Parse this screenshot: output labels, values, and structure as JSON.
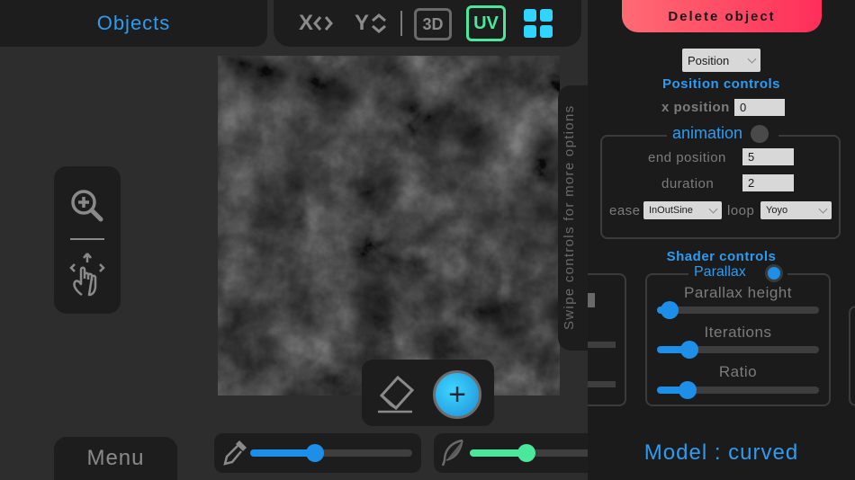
{
  "header": {
    "objects_label": "Objects",
    "toolbar": {
      "x_label": "X",
      "y_label": "Y",
      "three_d_label": "3D",
      "uv_label": "UV"
    }
  },
  "canvas": {
    "image": "cloudy noise texture"
  },
  "paint": {
    "add_symbol": "+"
  },
  "menu": {
    "label": "Menu"
  },
  "sliders": {
    "brush_size": 0.4,
    "softness": 0.45
  },
  "swipe_hint": "Swipe controls for more options",
  "right_panel": {
    "delete_label": "Delete object",
    "mode_select": "Position",
    "position_controls_title": "Position controls",
    "x_position_label": "x position",
    "x_position_value": "0",
    "animation_label": "animation",
    "end_position_label": "end position",
    "end_position_value": "5",
    "duration_label": "duration",
    "duration_value": "2",
    "ease_label": "ease",
    "ease_value": "InOutSine",
    "loop_label": "loop",
    "loop_value": "Yoyo",
    "shader_controls_title": "Shader controls",
    "parallax_label": "Parallax",
    "parallax_height_label": "Parallax height",
    "parallax_height": 0.08,
    "iterations_label": "Iterations",
    "iterations": 0.2,
    "ratio_label": "Ratio",
    "ratio": 0.19,
    "model_label": "Model : curved"
  },
  "colors": {
    "accent_blue": "#2f9bf0",
    "accent_green": "#4be89b",
    "delete_red": "#ff2e5a"
  }
}
